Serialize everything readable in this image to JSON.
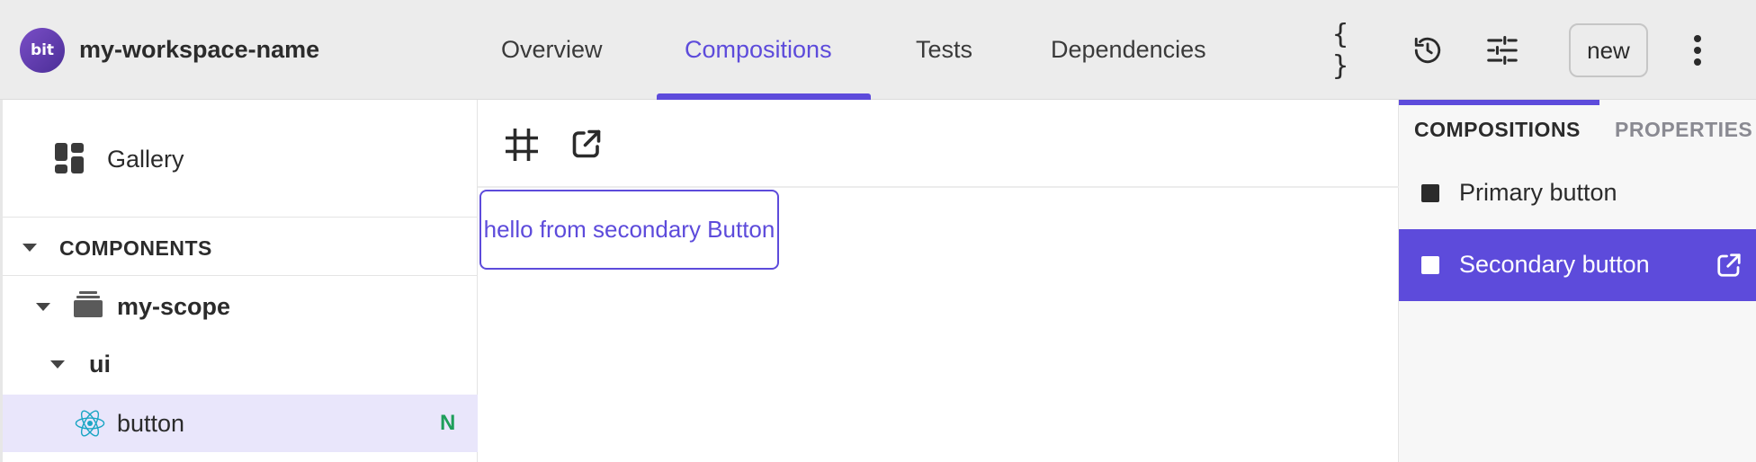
{
  "header": {
    "logo_text": "bit",
    "workspace_name": "my-workspace-name",
    "tabs": [
      {
        "label": "Overview",
        "active": false
      },
      {
        "label": "Compositions",
        "active": true
      },
      {
        "label": "Tests",
        "active": false
      },
      {
        "label": "Dependencies",
        "active": false
      }
    ],
    "icons": [
      "code-braces-icon",
      "history-icon",
      "settings-sliders-icon",
      "more-vertical-icon"
    ],
    "braces_glyph": "{ }",
    "new_label": "new"
  },
  "sidebar": {
    "gallery_label": "Gallery",
    "section_title": "COMPONENTS",
    "tree": [
      {
        "label": "my-scope",
        "icon": "scope-stack-icon",
        "expanded": true
      },
      {
        "label": "ui",
        "expanded": true
      },
      {
        "label": "button",
        "icon": "react-icon",
        "badge": "N",
        "selected": true
      }
    ]
  },
  "main": {
    "toolbar_icons": [
      "frame-crop-icon",
      "open-external-icon"
    ],
    "preview_text": "hello from secondary Button"
  },
  "right_panel": {
    "tabs": [
      {
        "label": "COMPOSITIONS",
        "active": true
      },
      {
        "label": "PROPERTIES",
        "active": false
      }
    ],
    "compositions": [
      {
        "label": "Primary button",
        "selected": false
      },
      {
        "label": "Secondary button",
        "selected": true
      }
    ]
  },
  "colors": {
    "accent": "#5d4bdb",
    "topbar_bg": "#ececec",
    "selected_row_bg": "#e9e6fb",
    "new_badge": "#1e9e5a"
  }
}
